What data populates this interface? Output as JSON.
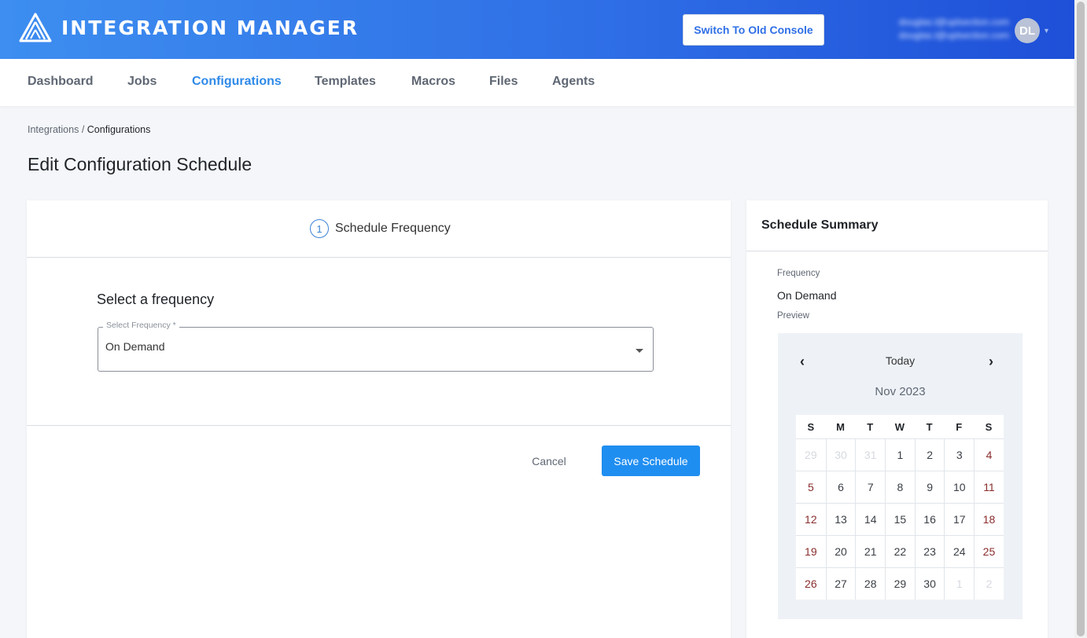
{
  "header": {
    "app_name": "INTEGRATION MANAGER",
    "switch_label": "Switch To Old Console",
    "user_name": "douglas.l@uplsection.com",
    "user_email": "douglas.l@uplsection.com",
    "avatar_initials": "DL",
    "brand_color": "#2f6fe6"
  },
  "nav": {
    "items": [
      {
        "label": "Dashboard"
      },
      {
        "label": "Jobs"
      },
      {
        "label": "Configurations",
        "active": true
      },
      {
        "label": "Templates"
      },
      {
        "label": "Macros"
      },
      {
        "label": "Files"
      },
      {
        "label": "Agents"
      }
    ]
  },
  "breadcrumb": {
    "parent": "Integrations",
    "separator": "/",
    "current": "Configurations"
  },
  "page_title": "Edit Configuration Schedule",
  "form": {
    "step_number": "1",
    "step_label": "Schedule Frequency",
    "section_title": "Select a frequency",
    "select_label": "Select Frequency *",
    "select_value": "On Demand",
    "cancel_label": "Cancel",
    "save_label": "Save Schedule"
  },
  "summary": {
    "title": "Schedule Summary",
    "frequency_label": "Frequency",
    "frequency_value": "On Demand",
    "preview_label": "Preview",
    "calendar": {
      "today_label": "Today",
      "month_label": "Nov 2023",
      "weekdays": [
        "S",
        "M",
        "T",
        "W",
        "T",
        "F",
        "S"
      ],
      "weeks": [
        [
          "29",
          "30",
          "31",
          "1",
          "2",
          "3",
          "4"
        ],
        [
          "5",
          "6",
          "7",
          "8",
          "9",
          "10",
          "11"
        ],
        [
          "12",
          "13",
          "14",
          "15",
          "16",
          "17",
          "18"
        ],
        [
          "19",
          "20",
          "21",
          "22",
          "23",
          "24",
          "25"
        ],
        [
          "26",
          "27",
          "28",
          "29",
          "30",
          "1",
          "2"
        ]
      ]
    }
  }
}
